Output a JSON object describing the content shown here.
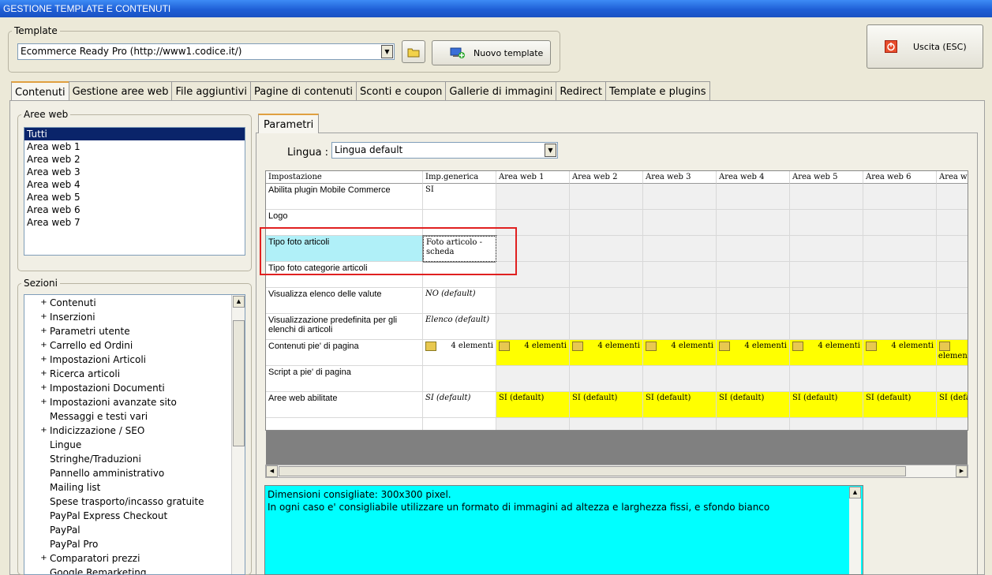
{
  "window": {
    "title": "GESTIONE TEMPLATE E CONTENUTI"
  },
  "template": {
    "legend": "Template",
    "selected": "Ecommerce Ready Pro (http://www1.codice.it/)",
    "new_button": "Nuovo template"
  },
  "exit_button": "Uscita (ESC)",
  "tabs": [
    {
      "label": "Contenuti"
    },
    {
      "label": "Gestione aree web"
    },
    {
      "label": "File aggiuntivi"
    },
    {
      "label": "Pagine di contenuti"
    },
    {
      "label": "Sconti e coupon"
    },
    {
      "label": "Gallerie di immagini"
    },
    {
      "label": "Redirect"
    },
    {
      "label": "Template e plugins"
    }
  ],
  "aree_web": {
    "legend": "Aree web",
    "items": [
      "Tutti",
      "Area web 1",
      "Area web 2",
      "Area web 3",
      "Area web 4",
      "Area web 5",
      "Area web 6",
      "Area web 7"
    ]
  },
  "sezioni": {
    "legend": "Sezioni",
    "items": [
      {
        "label": "Contenuti",
        "expandable": true
      },
      {
        "label": "Inserzioni",
        "expandable": true
      },
      {
        "label": "Parametri utente",
        "expandable": true
      },
      {
        "label": "Carrello ed Ordini",
        "expandable": true
      },
      {
        "label": "Impostazioni Articoli",
        "expandable": true
      },
      {
        "label": "Ricerca articoli",
        "expandable": true
      },
      {
        "label": "Impostazioni Documenti",
        "expandable": true
      },
      {
        "label": "Impostazioni avanzate sito",
        "expandable": true
      },
      {
        "label": "Messaggi e testi vari",
        "expandable": false
      },
      {
        "label": "Indicizzazione / SEO",
        "expandable": true
      },
      {
        "label": "Lingue",
        "expandable": false
      },
      {
        "label": "Stringhe/Traduzioni",
        "expandable": false
      },
      {
        "label": "Pannello amministrativo",
        "expandable": false
      },
      {
        "label": "Mailing list",
        "expandable": false
      },
      {
        "label": "Spese trasporto/incasso gratuite",
        "expandable": false
      },
      {
        "label": "PayPal Express Checkout",
        "expandable": false
      },
      {
        "label": "PayPal",
        "expandable": false
      },
      {
        "label": "PayPal Pro",
        "expandable": false
      },
      {
        "label": "Comparatori prezzi",
        "expandable": true
      },
      {
        "label": "Google Remarketing",
        "expandable": false
      }
    ]
  },
  "parametri": {
    "tab_label": "Parametri",
    "lingua_label": "Lingua :",
    "lingua_value": "Lingua default"
  },
  "grid": {
    "headers": [
      "Impostazione",
      "Imp.generica",
      "Area web 1",
      "Area web 2",
      "Area web 3",
      "Area web 4",
      "Area web 5",
      "Area web 6",
      "Area we"
    ],
    "rows": [
      {
        "label": "Abilita plugin Mobile Commerce",
        "generic": "SI",
        "italic": false,
        "areas": null
      },
      {
        "label": "Logo",
        "generic": "",
        "italic": false,
        "areas": null
      },
      {
        "label": "Tipo foto articoli",
        "generic": "Foto articolo - scheda",
        "italic": false,
        "areas": null,
        "selected": true
      },
      {
        "label": "Tipo foto categorie articoli",
        "generic": "",
        "italic": false,
        "areas": null
      },
      {
        "label": "Visualizza elenco delle valute",
        "generic": "NO (default)",
        "italic": true,
        "areas": null
      },
      {
        "label": "Visualizzazione predefinita per gli elenchi di articoli",
        "generic": "Elenco (default)",
        "italic": true,
        "areas": null
      },
      {
        "label": "Contenuti pie' di pagina",
        "generic": "4 elementi",
        "italic": false,
        "areas": "4 elementi",
        "folder": true
      },
      {
        "label": "Script a pie' di pagina",
        "generic": "",
        "italic": false,
        "areas": null
      },
      {
        "label": "Aree web abilitate",
        "generic": "SI (default)",
        "italic": true,
        "areas": "SI (default)"
      }
    ]
  },
  "description": {
    "line1": "Dimensioni consigliate: 300x300 pixel.",
    "line2": "In ogni caso e' consigliabile utilizzare un formato di immagini ad altezza e larghezza fissi, e sfondo bianco"
  },
  "colors": {
    "highlight_yellow": "#ffff00",
    "desc_bg": "#00ffff",
    "selection_box": "#e02020"
  }
}
